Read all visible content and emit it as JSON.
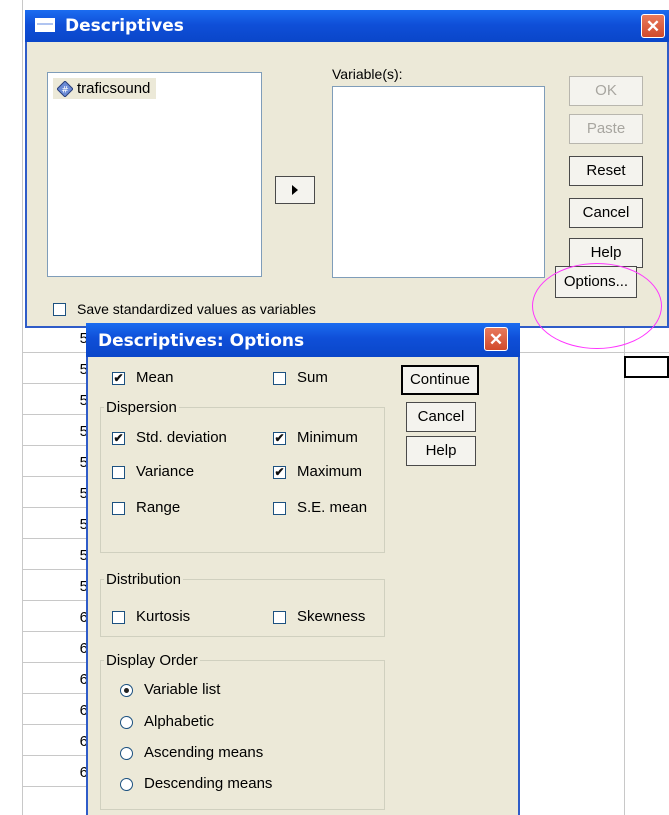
{
  "colors": {
    "titlebar": "#0a46c9",
    "dialog_bg": "#ece9d8",
    "highlight_ellipse": "#ff33ff"
  },
  "background_sheet": {
    "row_numbers": [
      "5",
      "5",
      "5",
      "5",
      "5",
      "5",
      "5",
      "5",
      "5",
      "6",
      "6",
      "6",
      "6",
      "6",
      "6"
    ]
  },
  "descriptives": {
    "title": "Descriptives",
    "source_list": [
      {
        "icon": "numeric-variable-icon",
        "name": "traficsound"
      }
    ],
    "variables_label": "Variable(s):",
    "buttons": {
      "ok": "OK",
      "paste": "Paste",
      "reset": "Reset",
      "cancel": "Cancel",
      "help": "Help",
      "options": "Options..."
    },
    "save_standardized": {
      "label": "Save standardized values as variables",
      "checked": false
    }
  },
  "options": {
    "title": "Descriptives: Options",
    "mean": {
      "label": "Mean",
      "checked": true
    },
    "sum": {
      "label": "Sum",
      "checked": false
    },
    "buttons": {
      "continue": "Continue",
      "cancel": "Cancel",
      "help": "Help"
    },
    "dispersion": {
      "title": "Dispersion",
      "std_deviation": {
        "label": "Std. deviation",
        "checked": true
      },
      "minimum": {
        "label": "Minimum",
        "checked": true
      },
      "variance": {
        "label": "Variance",
        "checked": false
      },
      "maximum": {
        "label": "Maximum",
        "checked": true
      },
      "range": {
        "label": "Range",
        "checked": false
      },
      "se_mean": {
        "label": "S.E. mean",
        "checked": false
      }
    },
    "distribution": {
      "title": "Distribution",
      "kurtosis": {
        "label": "Kurtosis",
        "checked": false
      },
      "skewness": {
        "label": "Skewness",
        "checked": false
      }
    },
    "display_order": {
      "title": "Display Order",
      "selected": "Variable list",
      "options": [
        "Variable list",
        "Alphabetic",
        "Ascending means",
        "Descending means"
      ]
    }
  }
}
